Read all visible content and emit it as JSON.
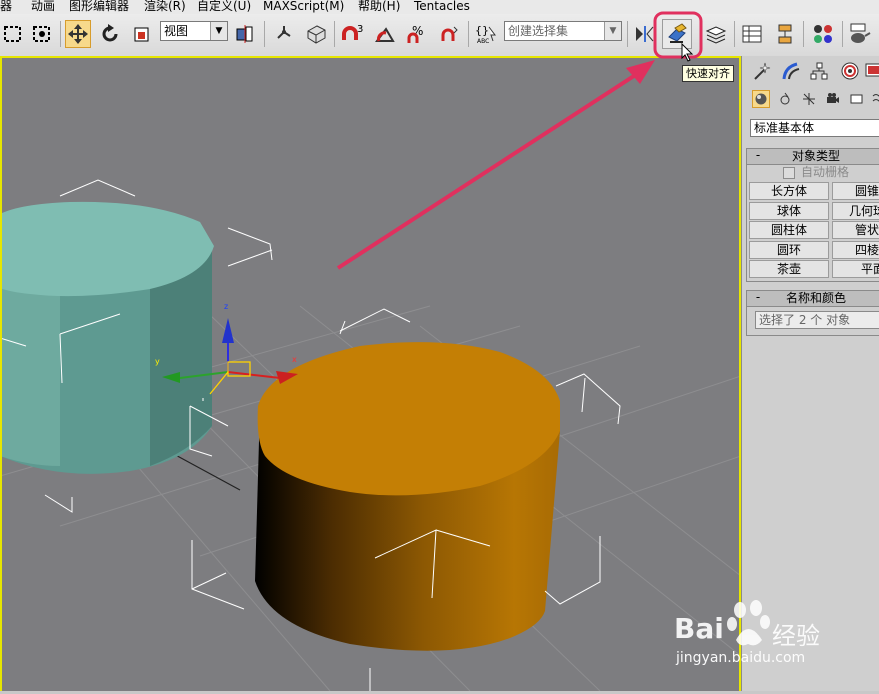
{
  "menubar": {
    "items": [
      "器",
      "动画",
      "图形编辑器",
      "渲染(R)",
      "自定义(U)",
      "MAXScript(M)",
      "帮助(H)",
      "Tentacles"
    ]
  },
  "toolbar": {
    "reference_coord_value": "视图",
    "selection_set_placeholder": "创建选择集",
    "tooltip": "快速对齐",
    "highlight_color": "#e0305e",
    "active_tool_color": "#f7d98b"
  },
  "command_panel": {
    "category": "标准基本体",
    "object_type": {
      "title": "对象类型",
      "autogrid_label": "自动栅格",
      "buttons": [
        "长方体",
        "圆锥体",
        "球体",
        "几何球体",
        "圆柱体",
        "管状体",
        "圆环",
        "四棱锥",
        "茶壶",
        "平面"
      ]
    },
    "name_color": {
      "title": "名称和颜色",
      "name_value": "选择了 2 个 对象"
    }
  },
  "viewport": {
    "background": "#7d7d80",
    "cyan_cylinder_color": "#7fbdb2",
    "orange_cylinder_color": "#c47f05",
    "gizmo_labels": {
      "x": "x",
      "y": "y",
      "z": "z"
    }
  },
  "watermark": {
    "brand_left": "Bai",
    "brand_right": "经验",
    "url": "jingyan.baidu.com"
  }
}
